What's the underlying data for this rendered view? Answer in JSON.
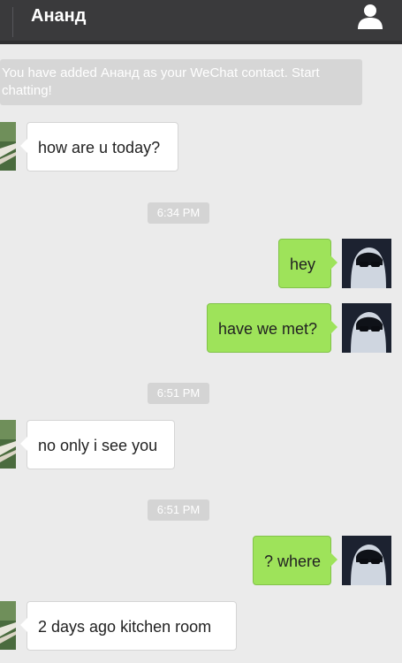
{
  "header": {
    "title": "Ананд",
    "profile_icon": "user-icon"
  },
  "system_notice": "You have added Ананд as your WeChat contact. Start chatting!",
  "timestamps": [
    "6:34 PM",
    "6:51 PM",
    "6:51 PM"
  ],
  "messages": [
    {
      "from": "contact",
      "text": "how are u today?"
    },
    {
      "from": "me",
      "text": "hey"
    },
    {
      "from": "me",
      "text": "have we met?"
    },
    {
      "from": "contact",
      "text": "no only i see you"
    },
    {
      "from": "me",
      "text": "? where"
    },
    {
      "from": "contact",
      "text": "2 days ago kitchen room"
    }
  ],
  "colors": {
    "topbar": "#3a3a3c",
    "background": "#ebebeb",
    "outgoing_bubble": "#9ee35a",
    "incoming_bubble": "#ffffff"
  }
}
